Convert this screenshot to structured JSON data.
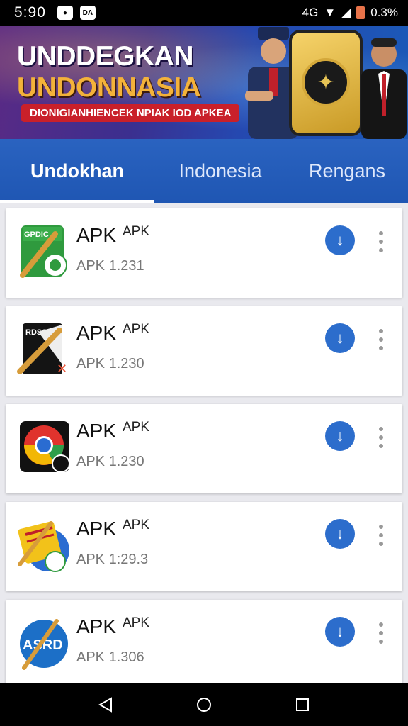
{
  "status_bar": {
    "time": "5:90",
    "left_badge": "DA",
    "signal_text": "4G",
    "battery_text": "0.3%"
  },
  "banner": {
    "title_line1": "UNDDEGKAN",
    "title_line2": "UNDONNASIA",
    "ribbon": "DIONIGIANHIENCEK NPIAK IOD APKEA"
  },
  "tabs": [
    {
      "label": "Undokhan",
      "active": true
    },
    {
      "label": "Indonesia",
      "active": false
    },
    {
      "label": "Rengans",
      "active": false
    }
  ],
  "apps": [
    {
      "name": "APK",
      "tag": "APK",
      "version": "APK 1.231",
      "icon": "green-pencil-app-icon",
      "icon_text": "GPDIC"
    },
    {
      "name": "APK",
      "tag": "APK",
      "version": "APK 1.230",
      "icon": "black-pencil-app-icon",
      "icon_text": "RDSS"
    },
    {
      "name": "APK",
      "tag": "APK",
      "version": "APK 1.230",
      "icon": "chrome-style-app-icon",
      "icon_text": ""
    },
    {
      "name": "APK",
      "tag": "APK",
      "version": "APK 1:29.3",
      "icon": "yellow-pencil-app-icon",
      "icon_text": ""
    },
    {
      "name": "APK",
      "tag": "APK",
      "version": "APK 1.306",
      "icon": "asrd-app-icon",
      "icon_text": "ASRD"
    }
  ],
  "colors": {
    "tab_bar": "#2a63c0",
    "download_button": "#2c6dcc",
    "banner_title_accent": "#f3b23a",
    "ribbon": "#c9202a"
  }
}
